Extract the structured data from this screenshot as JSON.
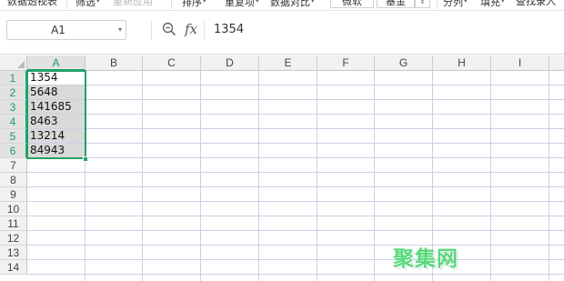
{
  "ribbon": {
    "items": [
      {
        "label": "数据透视表",
        "disabled": false
      },
      {
        "label": "筛选",
        "disabled": false,
        "caret": true
      },
      {
        "label": "重新应用",
        "disabled": true
      },
      {
        "label": "排序",
        "disabled": false,
        "caret": true
      },
      {
        "label": "重复项",
        "disabled": false,
        "caret": true
      },
      {
        "label": "数据对比",
        "disabled": false,
        "caret": true
      },
      {
        "label": "分列",
        "disabled": false,
        "caret": true
      },
      {
        "label": "填充",
        "disabled": false,
        "caret": true
      },
      {
        "label": "查找录入",
        "disabled": false
      }
    ],
    "font_box": "微软",
    "size_box": "基金",
    "caret_glyph": "▾",
    "spin_glyph": "⇕"
  },
  "formula_bar": {
    "name_box": "A1",
    "name_box_caret": "▾",
    "fx_label": "fx",
    "formula": "1354"
  },
  "grid": {
    "columns": [
      "A",
      "B",
      "C",
      "D",
      "E",
      "F",
      "G",
      "H",
      "I"
    ],
    "rows": [
      "1",
      "2",
      "3",
      "4",
      "5",
      "6",
      "7",
      "8",
      "9",
      "10",
      "11",
      "12",
      "13",
      "14"
    ],
    "selected_column": "A",
    "selected_rows": [
      "1",
      "2",
      "3",
      "4",
      "5",
      "6"
    ],
    "cells": [
      "1354",
      "5648",
      "141685",
      "8463",
      "13214",
      "84943"
    ]
  },
  "watermark": "聚集网",
  "colors": {
    "accent": "#21a366",
    "selection_fill": "#d9d9d9",
    "gridline": "#cfcfe6",
    "header_bg": "#f1f1f1",
    "watermark": "#46d66e"
  }
}
